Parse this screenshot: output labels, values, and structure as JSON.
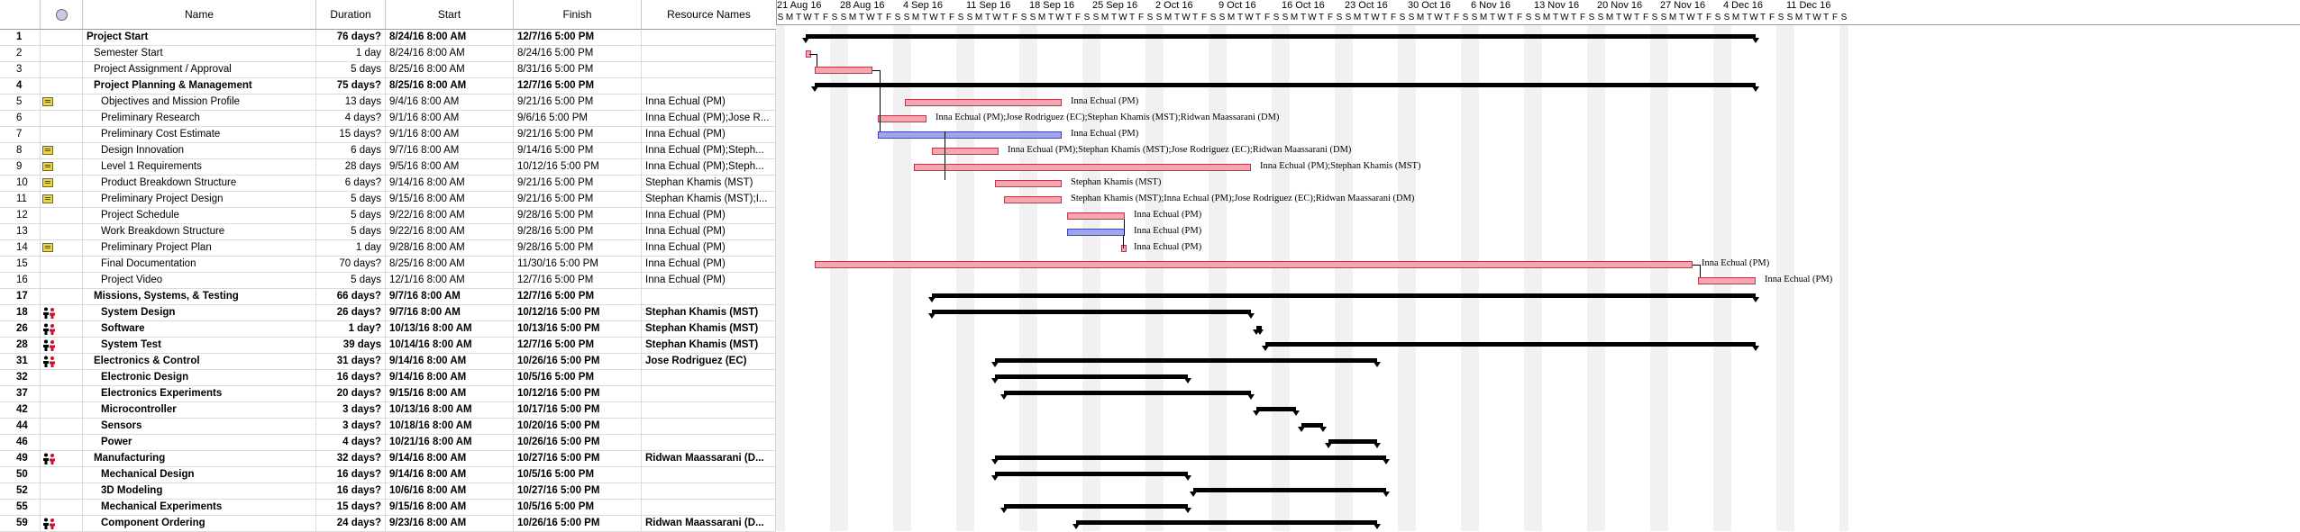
{
  "columns": {
    "id": "",
    "indicators": "",
    "name": "Name",
    "duration": "Duration",
    "start": "Start",
    "finish": "Finish",
    "resources": "Resource Names"
  },
  "tasks": [
    {
      "id": "1",
      "name": "Project Start",
      "duration": "76 days?",
      "start": "8/24/16 8:00 AM",
      "finish": "12/7/16 5:00 PM",
      "resources": "",
      "summary": true,
      "indent": 0,
      "indicator": ""
    },
    {
      "id": "2",
      "name": "Semester Start",
      "duration": "1 day",
      "start": "8/24/16 8:00 AM",
      "finish": "8/24/16 5:00 PM",
      "resources": "",
      "summary": false,
      "indent": 1,
      "indicator": ""
    },
    {
      "id": "3",
      "name": "Project Assignment / Approval",
      "duration": "5 days",
      "start": "8/25/16 8:00 AM",
      "finish": "8/31/16 5:00 PM",
      "resources": "",
      "summary": false,
      "indent": 1,
      "indicator": ""
    },
    {
      "id": "4",
      "name": "Project Planning & Management",
      "duration": "75 days?",
      "start": "8/25/16 8:00 AM",
      "finish": "12/7/16 5:00 PM",
      "resources": "",
      "summary": true,
      "indent": 1,
      "indicator": ""
    },
    {
      "id": "5",
      "name": "Objectives and Mission Profile",
      "duration": "13 days",
      "start": "9/4/16 8:00 AM",
      "finish": "9/21/16 5:00 PM",
      "resources": "Inna Echual (PM)",
      "summary": false,
      "indent": 2,
      "indicator": "note"
    },
    {
      "id": "6",
      "name": "Preliminary Research",
      "duration": "4 days?",
      "start": "9/1/16 8:00 AM",
      "finish": "9/6/16 5:00 PM",
      "resources": "Inna Echual (PM);Jose R...",
      "summary": false,
      "indent": 2,
      "indicator": ""
    },
    {
      "id": "7",
      "name": "Preliminary Cost Estimate",
      "duration": "15 days?",
      "start": "9/1/16 8:00 AM",
      "finish": "9/21/16 5:00 PM",
      "resources": "Inna Echual (PM)",
      "summary": false,
      "indent": 2,
      "indicator": ""
    },
    {
      "id": "8",
      "name": "Design Innovation",
      "duration": "6 days",
      "start": "9/7/16 8:00 AM",
      "finish": "9/14/16 5:00 PM",
      "resources": "Inna Echual (PM);Steph...",
      "summary": false,
      "indent": 2,
      "indicator": "note"
    },
    {
      "id": "9",
      "name": "Level 1 Requirements",
      "duration": "28 days",
      "start": "9/5/16 8:00 AM",
      "finish": "10/12/16 5:00 PM",
      "resources": "Inna Echual (PM);Steph...",
      "summary": false,
      "indent": 2,
      "indicator": "note"
    },
    {
      "id": "10",
      "name": "Product Breakdown Structure",
      "duration": "6 days?",
      "start": "9/14/16 8:00 AM",
      "finish": "9/21/16 5:00 PM",
      "resources": "Stephan Khamis (MST)",
      "summary": false,
      "indent": 2,
      "indicator": "note"
    },
    {
      "id": "11",
      "name": "Preliminary Project Design",
      "duration": "5 days",
      "start": "9/15/16 8:00 AM",
      "finish": "9/21/16 5:00 PM",
      "resources": "Stephan Khamis (MST);I...",
      "summary": false,
      "indent": 2,
      "indicator": "note"
    },
    {
      "id": "12",
      "name": "Project Schedule",
      "duration": "5 days",
      "start": "9/22/16 8:00 AM",
      "finish": "9/28/16 5:00 PM",
      "resources": "Inna Echual (PM)",
      "summary": false,
      "indent": 2,
      "indicator": ""
    },
    {
      "id": "13",
      "name": "Work Breakdown Structure",
      "duration": "5 days",
      "start": "9/22/16 8:00 AM",
      "finish": "9/28/16 5:00 PM",
      "resources": "Inna Echual (PM)",
      "summary": false,
      "indent": 2,
      "indicator": ""
    },
    {
      "id": "14",
      "name": "Preliminary Project Plan",
      "duration": "1 day",
      "start": "9/28/16 8:00 AM",
      "finish": "9/28/16 5:00 PM",
      "resources": "Inna Echual (PM)",
      "summary": false,
      "indent": 2,
      "indicator": "note"
    },
    {
      "id": "15",
      "name": "Final Documentation",
      "duration": "70 days?",
      "start": "8/25/16 8:00 AM",
      "finish": "11/30/16 5:00 PM",
      "resources": "Inna Echual (PM)",
      "summary": false,
      "indent": 2,
      "indicator": ""
    },
    {
      "id": "16",
      "name": "Project Video",
      "duration": "5 days",
      "start": "12/1/16 8:00 AM",
      "finish": "12/7/16 5:00 PM",
      "resources": "Inna Echual (PM)",
      "summary": false,
      "indent": 2,
      "indicator": ""
    },
    {
      "id": "17",
      "name": "Missions, Systems, & Testing",
      "duration": "66 days?",
      "start": "9/7/16 8:00 AM",
      "finish": "12/7/16 5:00 PM",
      "resources": "",
      "summary": true,
      "indent": 1,
      "indicator": ""
    },
    {
      "id": "18",
      "name": "System Design",
      "duration": "26 days?",
      "start": "9/7/16 8:00 AM",
      "finish": "10/12/16 5:00 PM",
      "resources": "Stephan Khamis (MST)",
      "summary": true,
      "indent": 2,
      "indicator": "resource"
    },
    {
      "id": "26",
      "name": "Software",
      "duration": "1 day?",
      "start": "10/13/16 8:00 AM",
      "finish": "10/13/16 5:00 PM",
      "resources": "Stephan Khamis (MST)",
      "summary": true,
      "indent": 2,
      "indicator": "resource"
    },
    {
      "id": "28",
      "name": "System Test",
      "duration": "39 days",
      "start": "10/14/16 8:00 AM",
      "finish": "12/7/16 5:00 PM",
      "resources": "Stephan Khamis (MST)",
      "summary": true,
      "indent": 2,
      "indicator": "resource"
    },
    {
      "id": "31",
      "name": "Electronics & Control",
      "duration": "31 days?",
      "start": "9/14/16 8:00 AM",
      "finish": "10/26/16 5:00 PM",
      "resources": "Jose Rodriguez (EC)",
      "summary": true,
      "indent": 1,
      "indicator": "resource"
    },
    {
      "id": "32",
      "name": "Electronic Design",
      "duration": "16 days?",
      "start": "9/14/16 8:00 AM",
      "finish": "10/5/16 5:00 PM",
      "resources": "",
      "summary": true,
      "indent": 2,
      "indicator": ""
    },
    {
      "id": "37",
      "name": "Electronics Experiments",
      "duration": "20 days?",
      "start": "9/15/16 8:00 AM",
      "finish": "10/12/16 5:00 PM",
      "resources": "",
      "summary": true,
      "indent": 2,
      "indicator": ""
    },
    {
      "id": "42",
      "name": "Microcontroller",
      "duration": "3 days?",
      "start": "10/13/16 8:00 AM",
      "finish": "10/17/16 5:00 PM",
      "resources": "",
      "summary": true,
      "indent": 2,
      "indicator": ""
    },
    {
      "id": "44",
      "name": "Sensors",
      "duration": "3 days?",
      "start": "10/18/16 8:00 AM",
      "finish": "10/20/16 5:00 PM",
      "resources": "",
      "summary": true,
      "indent": 2,
      "indicator": ""
    },
    {
      "id": "46",
      "name": "Power",
      "duration": "4 days?",
      "start": "10/21/16 8:00 AM",
      "finish": "10/26/16 5:00 PM",
      "resources": "",
      "summary": true,
      "indent": 2,
      "indicator": ""
    },
    {
      "id": "49",
      "name": "Manufacturing",
      "duration": "32 days?",
      "start": "9/14/16 8:00 AM",
      "finish": "10/27/16 5:00 PM",
      "resources": "Ridwan Maassarani (D...",
      "summary": true,
      "indent": 1,
      "indicator": "resource"
    },
    {
      "id": "50",
      "name": "Mechanical Design",
      "duration": "16 days?",
      "start": "9/14/16 8:00 AM",
      "finish": "10/5/16 5:00 PM",
      "resources": "",
      "summary": true,
      "indent": 2,
      "indicator": ""
    },
    {
      "id": "52",
      "name": "3D Modeling",
      "duration": "16 days?",
      "start": "10/6/16 8:00 AM",
      "finish": "10/27/16 5:00 PM",
      "resources": "",
      "summary": true,
      "indent": 2,
      "indicator": ""
    },
    {
      "id": "55",
      "name": "Mechanical Experiments",
      "duration": "15 days?",
      "start": "9/15/16 8:00 AM",
      "finish": "10/5/16 5:00 PM",
      "resources": "",
      "summary": true,
      "indent": 2,
      "indicator": ""
    },
    {
      "id": "59",
      "name": "Component Ordering",
      "duration": "24 days?",
      "start": "9/23/16 8:00 AM",
      "finish": "10/26/16 5:00 PM",
      "resources": "Ridwan Maassarani (D...",
      "summary": true,
      "indent": 2,
      "indicator": "resource"
    }
  ],
  "timeline": {
    "weeks": [
      "21 Aug 16",
      "28 Aug 16",
      "4 Sep 16",
      "11 Sep 16",
      "18 Sep 16",
      "25 Sep 16",
      "2 Oct 16",
      "9 Oct 16",
      "16 Oct 16",
      "23 Oct 16",
      "30 Oct 16",
      "6 Nov 16",
      "13 Nov 16",
      "20 Nov 16",
      "27 Nov 16",
      "4 Dec 16",
      "11 Dec 16"
    ],
    "day_letters": [
      "S",
      "M",
      "T",
      "W",
      "T",
      "F",
      "S"
    ]
  },
  "gantt_bars": [
    {
      "row": 0,
      "type": "summary",
      "label": ""
    },
    {
      "row": 1,
      "type": "task",
      "label": ""
    },
    {
      "row": 2,
      "type": "task",
      "label": ""
    },
    {
      "row": 3,
      "type": "summary",
      "label": ""
    },
    {
      "row": 4,
      "type": "task",
      "label": "Inna Echual (PM)"
    },
    {
      "row": 5,
      "type": "task",
      "label": "Inna Echual (PM);Jose Rodriguez (EC);Stephan Khamis (MST);Ridwan Maassarani (DM)"
    },
    {
      "row": 6,
      "type": "crit",
      "label": "Inna Echual (PM)"
    },
    {
      "row": 7,
      "type": "task",
      "label": "Inna Echual (PM);Stephan Khamis (MST);Jose Rodriguez (EC);Ridwan Maassarani (DM)"
    },
    {
      "row": 8,
      "type": "task",
      "label": "Inna Echual (PM);Stephan Khamis (MST)"
    },
    {
      "row": 9,
      "type": "task",
      "label": "Stephan Khamis (MST)"
    },
    {
      "row": 10,
      "type": "task",
      "label": "Stephan Khamis (MST);Inna Echual (PM);Jose Rodriguez (EC);Ridwan Maassarani (DM)"
    },
    {
      "row": 11,
      "type": "task",
      "label": "Inna Echual (PM)"
    },
    {
      "row": 12,
      "type": "crit",
      "label": "Inna Echual (PM)"
    },
    {
      "row": 13,
      "type": "task",
      "label": "Inna Echual (PM)"
    },
    {
      "row": 14,
      "type": "task",
      "label": "Inna Echual (PM)"
    },
    {
      "row": 15,
      "type": "task",
      "label": "Inna Echual (PM)"
    },
    {
      "row": 16,
      "type": "summary",
      "label": ""
    },
    {
      "row": 17,
      "type": "summary",
      "label": ""
    },
    {
      "row": 18,
      "type": "summary",
      "label": ""
    },
    {
      "row": 19,
      "type": "summary",
      "label": ""
    },
    {
      "row": 20,
      "type": "summary",
      "label": ""
    },
    {
      "row": 21,
      "type": "summary",
      "label": ""
    },
    {
      "row": 22,
      "type": "summary",
      "label": ""
    },
    {
      "row": 23,
      "type": "summary",
      "label": ""
    },
    {
      "row": 24,
      "type": "summary",
      "label": ""
    },
    {
      "row": 25,
      "type": "summary",
      "label": ""
    },
    {
      "row": 26,
      "type": "summary",
      "label": ""
    },
    {
      "row": 27,
      "type": "summary",
      "label": ""
    },
    {
      "row": 28,
      "type": "summary",
      "label": ""
    },
    {
      "row": 29,
      "type": "summary",
      "label": ""
    },
    {
      "row": 30,
      "type": "summary",
      "label": ""
    }
  ],
  "colors": {
    "task_fill": "#f4a7b0",
    "task_border": "#c0354a",
    "critical_fill": "#9fa6ee",
    "critical_border": "#3a44b8",
    "summary": "#000000",
    "weekend": "#f1f1f1"
  }
}
